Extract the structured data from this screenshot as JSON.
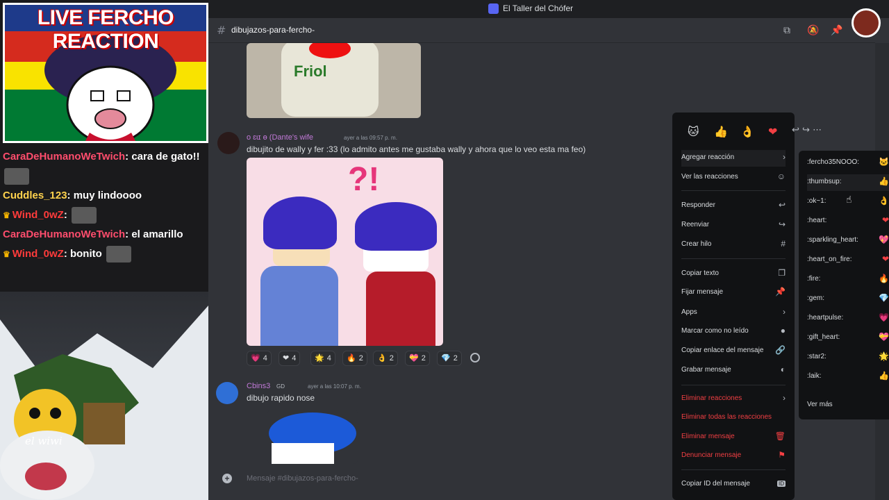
{
  "overlay": {
    "banner_title": "LIVE FERCHO REACTION",
    "chat": [
      {
        "user": "CaraDeHumanoWeTwich",
        "text": ": cara de gato!!",
        "color": "#ff4d6d",
        "crown": false,
        "emote": true
      },
      {
        "user": "Cuddles_123",
        "text": ": muy lindoooo",
        "color": "#ffd24d",
        "crown": false,
        "emote": false
      },
      {
        "user": "Wind_0wZ",
        "text": ":",
        "color": "#ff3b3b",
        "crown": true,
        "emote": true
      },
      {
        "user": "CaraDeHumanoWeTwich",
        "text": ": el amarillo",
        "color": "#ff4d6d",
        "crown": false,
        "emote": false
      },
      {
        "user": "Wind_0wZ",
        "text": ": bonito",
        "color": "#ff3b3b",
        "crown": true,
        "emote": true
      }
    ],
    "webcam_label": "el wiwi"
  },
  "app": {
    "title": "El Taller del Chófer"
  },
  "channel": {
    "name": "dibujazos-para-fercho-"
  },
  "messages": {
    "top_image_brand": "Friol",
    "msg1": {
      "author": "о ɛɩɪ ɵ (Dante's wife",
      "time": "ayer a las 09:57 p. m.",
      "text": "dibujito de wally y fer :33 (lo admito antes me gustaba wally y ahora que lo veo esta ma feo)"
    },
    "reactions": [
      {
        "glyph": "💗",
        "count": "4"
      },
      {
        "glyph": "❤",
        "count": "4"
      },
      {
        "glyph": "🌟",
        "count": "4"
      },
      {
        "glyph": "🔥",
        "count": "2"
      },
      {
        "glyph": "👌",
        "count": "2"
      },
      {
        "glyph": "💝",
        "count": "2"
      },
      {
        "glyph": "💎",
        "count": "2"
      }
    ],
    "msg2": {
      "author": "Cbins3",
      "badge": "GD",
      "time": "ayer a las 10:07 p. m.",
      "text": "dibujo rapido nose"
    }
  },
  "composer": {
    "placeholder": "Mensaje #dibujazos-para-fercho-"
  },
  "context_menu": {
    "quick_reactions": [
      "🐱",
      "👍",
      "👌",
      "❤"
    ],
    "items": [
      {
        "label": "Agregar reacción",
        "icon": "chevron-right-icon",
        "glyph": "›"
      },
      {
        "label": "Ver las reacciones",
        "icon": "smile-icon",
        "glyph": "☺"
      },
      {
        "label": "Responder",
        "icon": "reply-icon",
        "glyph": "↩"
      },
      {
        "label": "Reenviar",
        "icon": "forward-icon",
        "glyph": "↪"
      },
      {
        "label": "Crear hilo",
        "icon": "thread-icon",
        "glyph": "#"
      },
      {
        "label": "Copiar texto",
        "icon": "copy-icon",
        "glyph": "❐"
      },
      {
        "label": "Fijar mensaje",
        "icon": "pin-icon",
        "glyph": "📌"
      },
      {
        "label": "Apps",
        "icon": "chevron-right-icon",
        "glyph": "›"
      },
      {
        "label": "Marcar como no leído",
        "icon": "unread-icon",
        "glyph": "●"
      },
      {
        "label": "Copiar enlace del mensaje",
        "icon": "link-icon",
        "glyph": "🔗"
      },
      {
        "label": "Grabar mensaje",
        "icon": "speak-icon",
        "glyph": "◐"
      },
      {
        "label": "Eliminar reacciones",
        "icon": "chevron-right-icon",
        "glyph": "›"
      },
      {
        "label": "Eliminar todas las reacciones",
        "icon": "",
        "glyph": ""
      },
      {
        "label": "Eliminar mensaje",
        "icon": "trash-icon",
        "glyph": "🗑"
      },
      {
        "label": "Denunciar mensaje",
        "icon": "flag-icon",
        "glyph": "⚑"
      },
      {
        "label": "Copiar ID del mensaje",
        "icon": "id-icon",
        "glyph": "ID"
      }
    ]
  },
  "submenu": {
    "items": [
      {
        "label": ":fercho35NOOO:",
        "glyph": "🐱"
      },
      {
        "label": ":thumbsup:",
        "glyph": "👍"
      },
      {
        "label": ":ok~1:",
        "glyph": "👌"
      },
      {
        "label": ":heart:",
        "glyph": "❤"
      },
      {
        "label": ":sparkling_heart:",
        "glyph": "💖"
      },
      {
        "label": ":heart_on_fire:",
        "glyph": "❤"
      },
      {
        "label": ":fire:",
        "glyph": "🔥"
      },
      {
        "label": ":gem:",
        "glyph": "💎"
      },
      {
        "label": ":heartpulse:",
        "glyph": "💗"
      },
      {
        "label": ":gift_heart:",
        "glyph": "💝"
      },
      {
        "label": ":star2:",
        "glyph": "🌟"
      },
      {
        "label": ":laik:",
        "glyph": "👍"
      }
    ],
    "more": "Ver más"
  },
  "colors": {
    "accent": "#5865f2",
    "danger": "#f23f43",
    "background": "#313338",
    "menu": "#111214"
  }
}
